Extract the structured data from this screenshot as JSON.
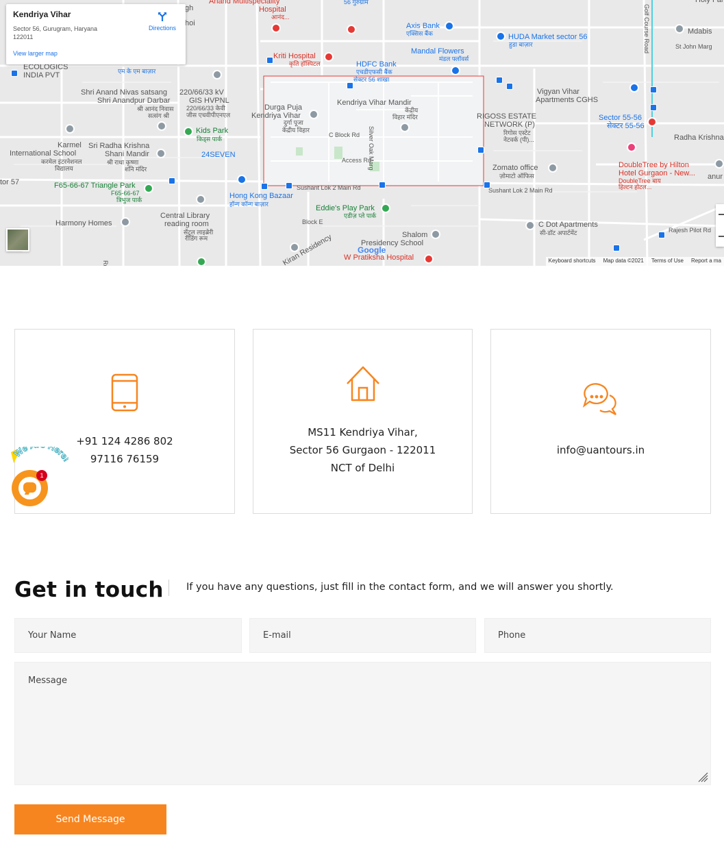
{
  "map": {
    "place_title": "Kendriya Vihar",
    "place_address": "Sector 56, Gurugram, Haryana 122011",
    "directions_label": "Directions",
    "view_larger_label": "View larger map",
    "attribution": [
      "Keyboard shortcuts",
      "Map data ©2021",
      "Terms of Use",
      "Report a ma"
    ],
    "google_logo": "Google",
    "labels": [
      {
        "text": "Anand Multispeciality",
        "color": "red"
      },
      {
        "text": "Hospital",
        "color": "red"
      },
      {
        "text": "आनंद...",
        "color": "red",
        "size": "hi"
      },
      {
        "text": "56 गुरुग्राम",
        "color": "blue",
        "size": "hi"
      },
      {
        "text": "Axis Bank",
        "color": "blue"
      },
      {
        "text": "एक्सिस बैंक",
        "color": "blue",
        "size": "hi"
      },
      {
        "text": "HUDA Market sector 56",
        "color": "blue"
      },
      {
        "text": "हुडा बाज़ार",
        "color": "blue",
        "size": "hi"
      },
      {
        "text": "Mdabis",
        "color": "grey"
      },
      {
        "text": "St John Marg",
        "color": "grey",
        "size": "hi"
      },
      {
        "text": "Kriti Hospital",
        "color": "red"
      },
      {
        "text": "कृति हॉस्पिटल",
        "color": "red",
        "size": "hi"
      },
      {
        "text": "HDFC Bank",
        "color": "blue"
      },
      {
        "text": "एचडीएफसी बैंक",
        "color": "blue",
        "size": "hi"
      },
      {
        "text": "सेक्टर 56 शाखा",
        "color": "blue",
        "size": "hi"
      },
      {
        "text": "Mandal Flowers",
        "color": "blue"
      },
      {
        "text": "मंडल फ्लॉवर्स",
        "color": "blue",
        "size": "hi"
      },
      {
        "text": "ECOLOGICS",
        "color": "grey"
      },
      {
        "text": "INDIA PVT",
        "color": "grey"
      },
      {
        "text": "एम के एम बाज़ार",
        "color": "blue",
        "size": "hi"
      },
      {
        "text": "Shri Anand Nivas satsang",
        "color": "grey"
      },
      {
        "text": "Shri Anandpur Darbar",
        "color": "grey"
      },
      {
        "text": "श्री आनंद निवास",
        "color": "grey",
        "size": "hi"
      },
      {
        "text": "सत्संग श्री",
        "color": "grey",
        "size": "hi"
      },
      {
        "text": "220/66/33 kV",
        "color": "grey"
      },
      {
        "text": "GIS HVPNL",
        "color": "grey"
      },
      {
        "text": "220/66/33 केवी",
        "color": "grey",
        "size": "hi"
      },
      {
        "text": "जीस एचवीपीएनएल",
        "color": "grey",
        "size": "hi"
      },
      {
        "text": "Vigyan Vihar",
        "color": "grey"
      },
      {
        "text": "Apartments CGHS",
        "color": "grey"
      },
      {
        "text": "Durga Puja",
        "color": "grey"
      },
      {
        "text": "Kendriya Vihar",
        "color": "grey"
      },
      {
        "text": "दुर्गा पूजा",
        "color": "grey",
        "size": "hi"
      },
      {
        "text": "केंद्रीय विहार",
        "color": "grey",
        "size": "hi"
      },
      {
        "text": "Kendriya Vihar Mandir",
        "color": "grey"
      },
      {
        "text": "केंद्रीय",
        "color": "grey",
        "size": "hi"
      },
      {
        "text": "विहार मंदिर",
        "color": "grey",
        "size": "hi"
      },
      {
        "text": "C Block Rd",
        "color": "grey",
        "size": "hi"
      },
      {
        "text": "Silver Oak Marg",
        "color": "grey",
        "size": "hi"
      },
      {
        "text": "Access Rd",
        "color": "grey",
        "size": "hi"
      },
      {
        "text": "RIGOSS ESTATE",
        "color": "grey"
      },
      {
        "text": "NETWORK (P)",
        "color": "grey"
      },
      {
        "text": "रिगोस एस्टेट",
        "color": "grey",
        "size": "hi"
      },
      {
        "text": "नेटवर्क (पी)...",
        "color": "grey",
        "size": "hi"
      },
      {
        "text": "Sector 55-56",
        "color": "blue"
      },
      {
        "text": "सेक्टर 55-56",
        "color": "blue"
      },
      {
        "text": "Radha Krishna",
        "color": "grey"
      },
      {
        "text": "Kids Park",
        "color": "green"
      },
      {
        "text": "किड्स पार्क",
        "color": "green",
        "size": "hi"
      },
      {
        "text": "Karmel",
        "color": "grey"
      },
      {
        "text": "International School",
        "color": "grey"
      },
      {
        "text": "करमेल इंटरनेशनल",
        "color": "grey",
        "size": "hi"
      },
      {
        "text": "विद्यालय",
        "color": "grey",
        "size": "hi"
      },
      {
        "text": "Sri Radha Krishna",
        "color": "grey"
      },
      {
        "text": "Shani Mandir",
        "color": "grey"
      },
      {
        "text": "श्री राधा कृष्णा",
        "color": "grey",
        "size": "hi"
      },
      {
        "text": "शनि मंदिर",
        "color": "grey",
        "size": "hi"
      },
      {
        "text": "24SEVEN",
        "color": "blue"
      },
      {
        "text": "DoubleTree by Hilton",
        "color": "red"
      },
      {
        "text": "Hotel Gurgaon - New...",
        "color": "red"
      },
      {
        "text": "DoubleTree बाय",
        "color": "red",
        "size": "hi"
      },
      {
        "text": "हिल्टन होटल...",
        "color": "red",
        "size": "hi"
      },
      {
        "text": "Zomato office",
        "color": "grey"
      },
      {
        "text": "ज़ोमाटो ऑफिस",
        "color": "grey",
        "size": "hi"
      },
      {
        "text": "tor 57",
        "color": "grey"
      },
      {
        "text": "F65-66-67 Triangle Park",
        "color": "green"
      },
      {
        "text": "F65-66-67",
        "color": "green",
        "size": "hi"
      },
      {
        "text": "त्रिभुज पार्क",
        "color": "green",
        "size": "hi"
      },
      {
        "text": "Sushant Lok 2 Main Rd",
        "color": "grey",
        "size": "hi"
      },
      {
        "text": "Sushant Lok 2 Main Rd",
        "color": "grey",
        "size": "hi"
      },
      {
        "text": "Hong Kong Bazaar",
        "color": "blue"
      },
      {
        "text": "हॉन्ग कॉन्ग बाज़ार",
        "color": "blue",
        "size": "hi"
      },
      {
        "text": "Eddie's Play Park",
        "color": "green"
      },
      {
        "text": "एडीज़ प्ले पार्क",
        "color": "green",
        "size": "hi"
      },
      {
        "text": "Central Library",
        "color": "grey"
      },
      {
        "text": "reading room",
        "color": "grey"
      },
      {
        "text": "सेंट्रल लाइब्रेरी",
        "color": "grey",
        "size": "hi"
      },
      {
        "text": "रीडिंग रूम",
        "color": "grey",
        "size": "hi"
      },
      {
        "text": "Harmony Homes",
        "color": "grey"
      },
      {
        "text": "C Dot Apartments",
        "color": "grey"
      },
      {
        "text": "सी-डॉट अपार्टमेंट",
        "color": "grey",
        "size": "hi"
      },
      {
        "text": "Shalom",
        "color": "grey"
      },
      {
        "text": "Presidency School",
        "color": "grey"
      },
      {
        "text": "W Pratiksha Hospital",
        "color": "red"
      },
      {
        "text": "Rajesh Pilot Rd",
        "color": "grey",
        "size": "hi"
      },
      {
        "text": "Block E",
        "color": "grey",
        "size": "hi"
      },
      {
        "text": "Kiran Residency",
        "color": "grey"
      },
      {
        "text": "Rd to F Block",
        "color": "grey",
        "size": "hi"
      },
      {
        "text": "anur",
        "color": "grey"
      },
      {
        "text": "Golf Course Road",
        "color": "grey",
        "size": "hi"
      },
      {
        "text": "gh",
        "color": "grey"
      },
      {
        "text": "hoi",
        "color": "grey"
      },
      {
        "text": "Holy Family",
        "color": "grey"
      }
    ]
  },
  "cards": [
    {
      "icon": "phone-icon",
      "lines": [
        "+91 124 4286 802",
        "97116 76159"
      ]
    },
    {
      "icon": "home-icon",
      "lines": [
        "MS11 Kendriya Vihar,",
        "Sector 56 Gurgaon - 122011",
        "NCT of Delhi"
      ]
    },
    {
      "icon": "chat-icon",
      "lines": [
        "info@uantours.in"
      ]
    }
  ],
  "chat_widget": {
    "tagline": "We Are Here!",
    "badge_count": "1"
  },
  "contact": {
    "title": "Get in touch",
    "subtitle": "If you have any questions, just fill in the contact form, and we will answer you shortly.",
    "name_placeholder": "Your Name",
    "email_placeholder": "E-mail",
    "phone_placeholder": "Phone",
    "message_placeholder": "Message",
    "submit_label": "Send Message"
  },
  "colors": {
    "accent": "#f7851f",
    "card_border": "#dcdcdc",
    "input_bg": "#f5f5f5"
  }
}
